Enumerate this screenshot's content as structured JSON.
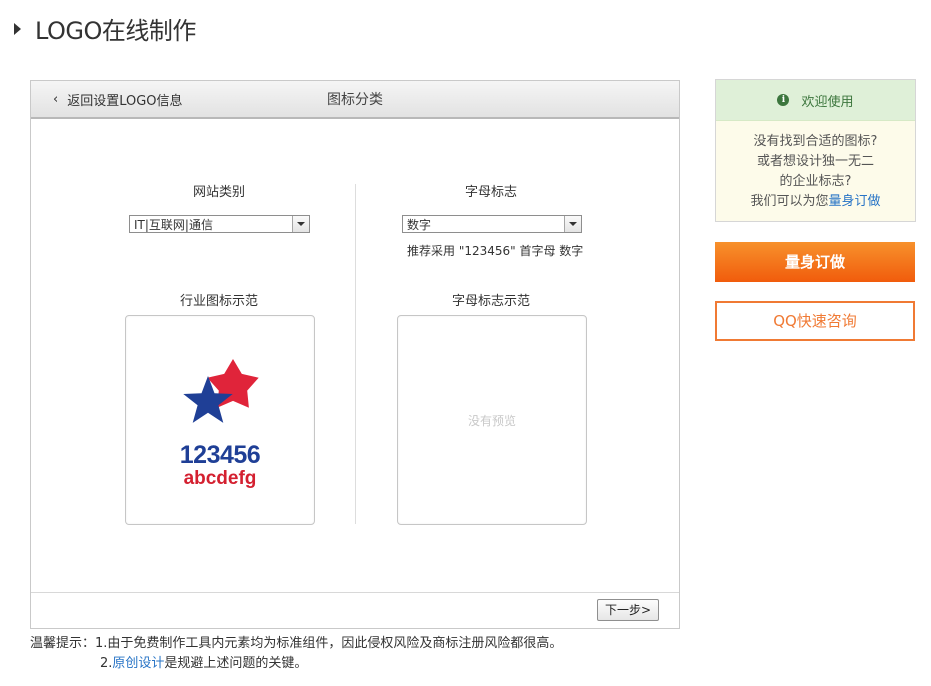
{
  "page": {
    "title": "LOGO在线制作"
  },
  "panel": {
    "back_link": "返回设置LOGO信息",
    "title": "图标分类",
    "left": {
      "select_label": "网站类别",
      "select_value": "IT|互联网|通信",
      "preview_label": "行业图标示范",
      "sample_number": "123456",
      "sample_letters": "abcdefg"
    },
    "right": {
      "select_label": "字母标志",
      "select_value": "数字",
      "hint": "推荐采用 \"123456\" 首字母 数字",
      "preview_label": "字母标志示范",
      "no_preview": "没有预览"
    },
    "next_button": "下一步>"
  },
  "tips": {
    "prefix": "温馨提示：",
    "line1": "1.由于免费制作工具内元素均为标准组件，因此侵权风险及商标注册风险都很高。",
    "line2_num": "2.",
    "line2_link": "原创设计",
    "line2_rest": "是规避上述问题的关键。"
  },
  "sidebar": {
    "welcome": "欢迎使用",
    "line1": "没有找到合适的图标?",
    "line2": "或者想设计独一无二",
    "line3": "的企业标志?",
    "line4_prefix": "我们可以为您",
    "line4_link": "量身订做",
    "custom_button": "量身订做",
    "qq_button": "QQ快速咨询"
  },
  "colors": {
    "orange": "#f15c0c",
    "link_blue": "#2874c6",
    "star_red": "#e0243a",
    "star_blue": "#1f3f96",
    "welcome_green": "#3c763d"
  }
}
